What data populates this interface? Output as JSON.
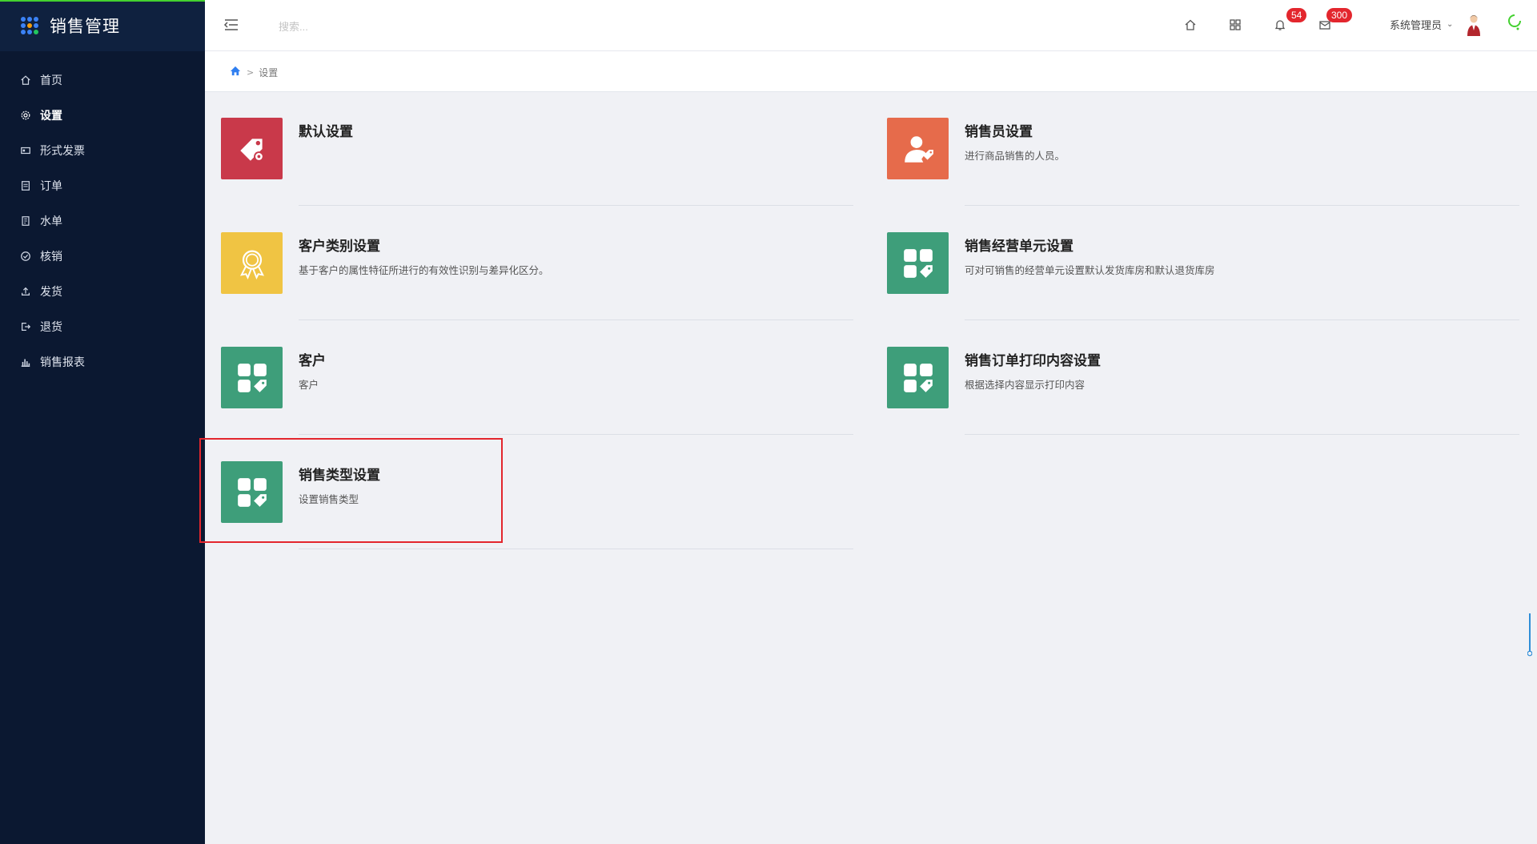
{
  "sidebar": {
    "app_title": "销售管理",
    "items": [
      {
        "label": "首页",
        "icon": "home-icon"
      },
      {
        "label": "设置",
        "icon": "gear-icon",
        "active": true
      },
      {
        "label": "形式发票",
        "icon": "invoice-icon"
      },
      {
        "label": "订单",
        "icon": "order-icon"
      },
      {
        "label": "水单",
        "icon": "receipt-icon"
      },
      {
        "label": "核销",
        "icon": "check-circle-icon"
      },
      {
        "label": "发货",
        "icon": "upload-icon"
      },
      {
        "label": "退货",
        "icon": "exit-icon"
      },
      {
        "label": "销售报表",
        "icon": "bar-chart-icon"
      }
    ]
  },
  "header": {
    "search_placeholder": "搜索...",
    "notifications_count": "54",
    "messages_count": "300",
    "user_name": "系统管理员"
  },
  "breadcrumb": {
    "home_icon": "home-icon",
    "separator": ">",
    "current": "设置"
  },
  "cards": [
    {
      "title": "默认设置",
      "desc": "",
      "icon": "tag-gear-icon",
      "color": "#c9394a"
    },
    {
      "title": "销售员设置",
      "desc": "进行商品销售的人员。",
      "icon": "salesperson-icon",
      "color": "#e66b4b"
    },
    {
      "title": "客户类别设置",
      "desc": "基于客户的属性特征所进行的有效性识别与差异化区分。",
      "icon": "award-icon",
      "color": "#f0c443"
    },
    {
      "title": "销售经营单元设置",
      "desc": "可对可销售的经营单元设置默认发货库房和默认退货库房",
      "icon": "grid-tag-icon",
      "color": "#3e9e7a"
    },
    {
      "title": "客户",
      "desc": "客户",
      "icon": "grid-tag-icon",
      "color": "#3e9e7a"
    },
    {
      "title": "销售订单打印内容设置",
      "desc": "根据选择内容显示打印内容",
      "icon": "grid-tag-icon",
      "color": "#3e9e7a"
    },
    {
      "title": "销售类型设置",
      "desc": "设置销售类型",
      "icon": "grid-tag-icon",
      "color": "#3e9e7a"
    }
  ],
  "colors": {
    "sidebar_bg": "#0b1831",
    "accent_badge": "#e3262d",
    "highlight_border": "#e3262d"
  }
}
